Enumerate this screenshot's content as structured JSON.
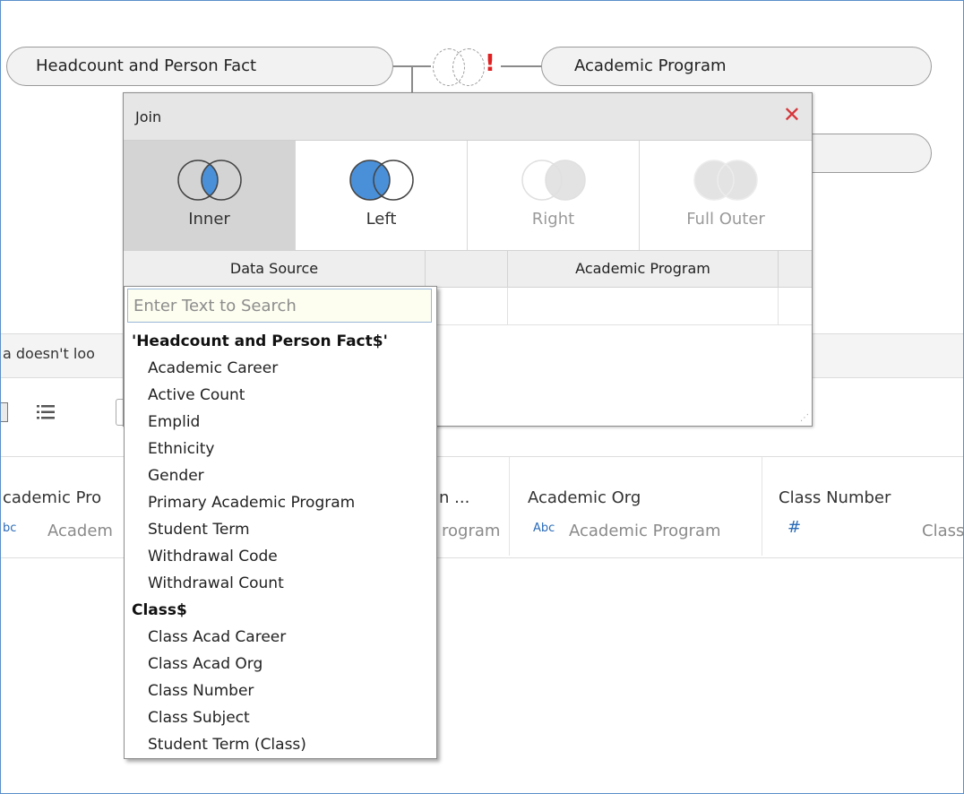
{
  "canvas": {
    "left_table": "Headcount and Person Fact",
    "right_table": "Academic Program"
  },
  "join_dialog": {
    "title": "Join",
    "close_glyph": "✕",
    "join_types": [
      {
        "label": "Inner",
        "selected": true,
        "enabled": true
      },
      {
        "label": "Left",
        "selected": false,
        "enabled": true
      },
      {
        "label": "Right",
        "selected": false,
        "enabled": false
      },
      {
        "label": "Full Outer",
        "selected": false,
        "enabled": false
      }
    ],
    "columns": [
      "Data Source",
      "",
      "Academic Program",
      ""
    ],
    "resize_glyph": "⋰"
  },
  "warning_text": "a doesn't loo",
  "data_grid": {
    "columns": [
      {
        "name": "cademic Pro",
        "type_icon": "Abc",
        "type_label": "bc",
        "source": "Academ"
      },
      {
        "name": "n ...",
        "type_icon": "",
        "type_label": "",
        "source": "rogram"
      },
      {
        "name": "Academic Org",
        "type_icon": "Abc",
        "type_label": "Abc",
        "source": "Academic Program"
      },
      {
        "name": "Class Number",
        "type_icon": "#",
        "type_label": "#",
        "source": "Class"
      }
    ]
  },
  "dropdown": {
    "search_placeholder": "Enter Text to Search",
    "groups": [
      {
        "header": "'Headcount and Person Fact$'",
        "items": [
          "Academic Career",
          "Active Count",
          "Emplid",
          "Ethnicity",
          "Gender",
          "Primary Academic Program",
          "Student Term",
          "Withdrawal Code",
          "Withdrawal Count"
        ]
      },
      {
        "header": "Class$",
        "items": [
          "Class Acad Career",
          "Class Acad Org",
          "Class Number",
          "Class Subject",
          "Student Term (Class)"
        ]
      }
    ]
  },
  "colors": {
    "accent_blue": "#4a90d9",
    "error_red": "#e02020",
    "close_red": "#d6363a",
    "frame_border": "#5b8fc9"
  }
}
